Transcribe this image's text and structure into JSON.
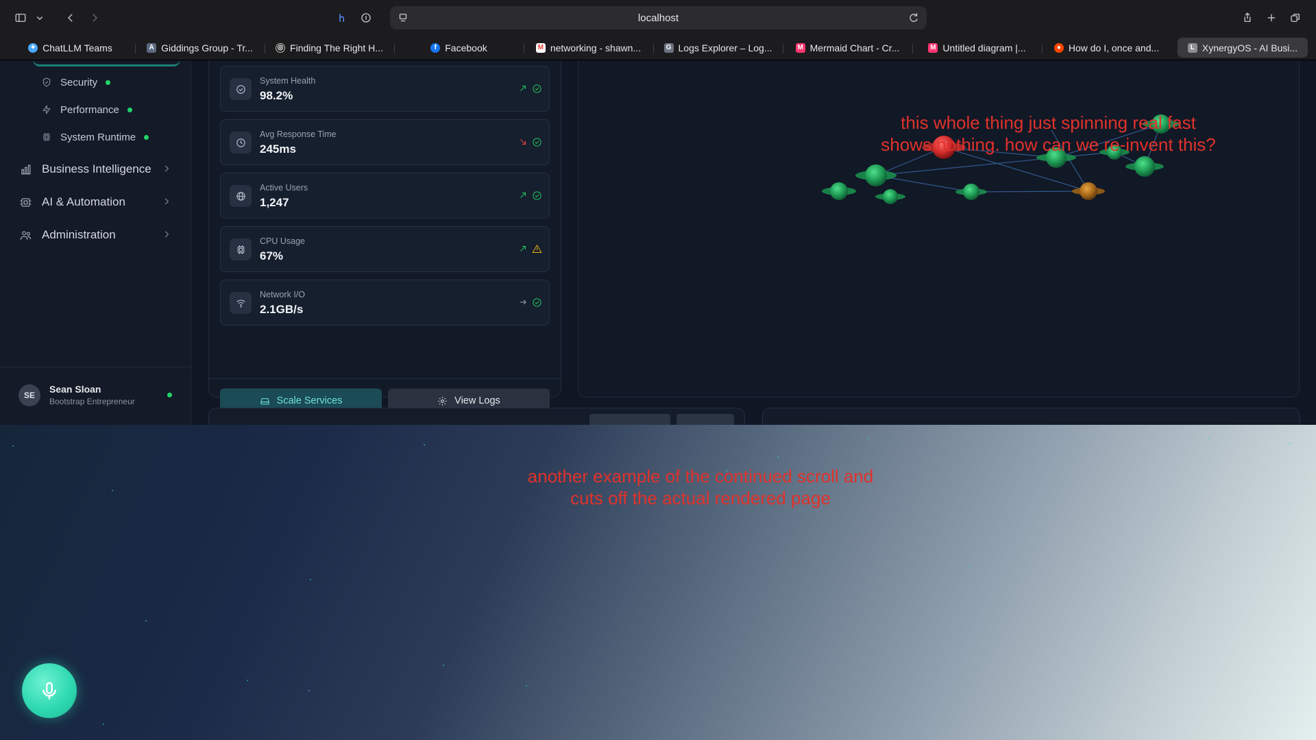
{
  "browser": {
    "url": "localhost",
    "tabs": [
      {
        "label": "ChatLLM Teams",
        "icon": "chatllm-icon",
        "color": "#4aa8ff"
      },
      {
        "label": "Giddings Group - Tr...",
        "icon": "giddings-icon",
        "color": "#5b6b80"
      },
      {
        "label": "Finding The Right H...",
        "icon": "finding-icon",
        "color": "#a0a0a0"
      },
      {
        "label": "Facebook",
        "icon": "facebook-icon",
        "color": "#1877f2"
      },
      {
        "label": "networking - shawn...",
        "icon": "gmail-icon",
        "color": "#ea4335"
      },
      {
        "label": "Logs Explorer – Log...",
        "icon": "google-cloud-icon",
        "color": "#6b7280"
      },
      {
        "label": "Mermaid Chart - Cr...",
        "icon": "mermaid-icon",
        "color": "#ff3670"
      },
      {
        "label": "Untitled diagram |...",
        "icon": "mermaid-icon",
        "color": "#ff3670"
      },
      {
        "label": "How do I, once and...",
        "icon": "reddit-icon",
        "color": "#ff4500"
      },
      {
        "label": "XynergyOS - AI Busi...",
        "icon": "xynergy-icon",
        "color": "#8e8e93"
      }
    ]
  },
  "sidebar": {
    "sub_items": [
      {
        "label": "Security",
        "icon": "shield-icon"
      },
      {
        "label": "Performance",
        "icon": "bolt-icon"
      },
      {
        "label": "System Runtime",
        "icon": "cpu-icon"
      }
    ],
    "sections": [
      {
        "label": "Business Intelligence",
        "icon": "bar-chart-icon"
      },
      {
        "label": "AI & Automation",
        "icon": "chip-icon"
      },
      {
        "label": "Administration",
        "icon": "users-icon"
      }
    ],
    "user": {
      "initials": "SE",
      "name": "Sean Sloan",
      "role": "Bootstrap Entrepreneur"
    }
  },
  "metrics": [
    {
      "label": "System Health",
      "value": "98.2%",
      "icon": "check-circle-icon",
      "trend": "up",
      "status": "ok"
    },
    {
      "label": "Avg Response Time",
      "value": "245ms",
      "icon": "clock-icon",
      "trend": "down",
      "status": "ok"
    },
    {
      "label": "Active Users",
      "value": "1,247",
      "icon": "globe-icon",
      "trend": "up",
      "status": "ok"
    },
    {
      "label": "CPU Usage",
      "value": "67%",
      "icon": "cpu-icon",
      "trend": "up",
      "status": "warning"
    },
    {
      "label": "Network I/O",
      "value": "2.1GB/s",
      "icon": "wifi-icon",
      "trend": "flat",
      "status": "ok"
    }
  ],
  "actions": {
    "scale": "Scale Services",
    "logs": "View Logs"
  },
  "annotations": {
    "first": "this whole thing just spinning real fast shows nothing. how can we re-invent this?",
    "second": "another example of the continued scroll and cuts off the actual rendered page"
  },
  "colors": {
    "ok": "#22c55e",
    "warning": "#eab308",
    "trend_up": "#22c55e",
    "trend_down": "#ef4444",
    "accent": "#2dd4bf",
    "annotation": "#e0322b"
  }
}
